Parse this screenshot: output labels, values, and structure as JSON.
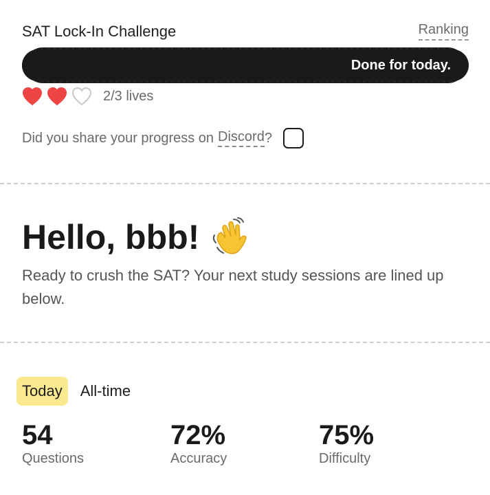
{
  "header": {
    "title": "SAT Lock-In Challenge",
    "ranking_label": "Ranking"
  },
  "progress": {
    "label": "Done for today.",
    "value": 1.0
  },
  "lives": {
    "filled": 2,
    "total": 3,
    "text": "2/3 lives",
    "filled_color": "#ef4444",
    "empty_color": "#c9c9c9"
  },
  "share": {
    "text": "Did you share your progress on",
    "link": "Discord",
    "suffix": "?",
    "checked": false
  },
  "greeting": {
    "title": "Hello, bbb!",
    "emoji": "waving-hand-icon",
    "subtitle": "Ready to crush the SAT? Your next study sessions are lined up below."
  },
  "tabs": [
    {
      "label": "Today",
      "active": true
    },
    {
      "label": "All-time",
      "active": false
    }
  ],
  "stats": [
    {
      "value": "54",
      "label": "Questions"
    },
    {
      "value": "72%",
      "label": "Accuracy"
    },
    {
      "value": "75%",
      "label": "Difficulty"
    }
  ],
  "colors": {
    "accent_tab": "#fbe98f",
    "bar": "#1a1a1a"
  }
}
